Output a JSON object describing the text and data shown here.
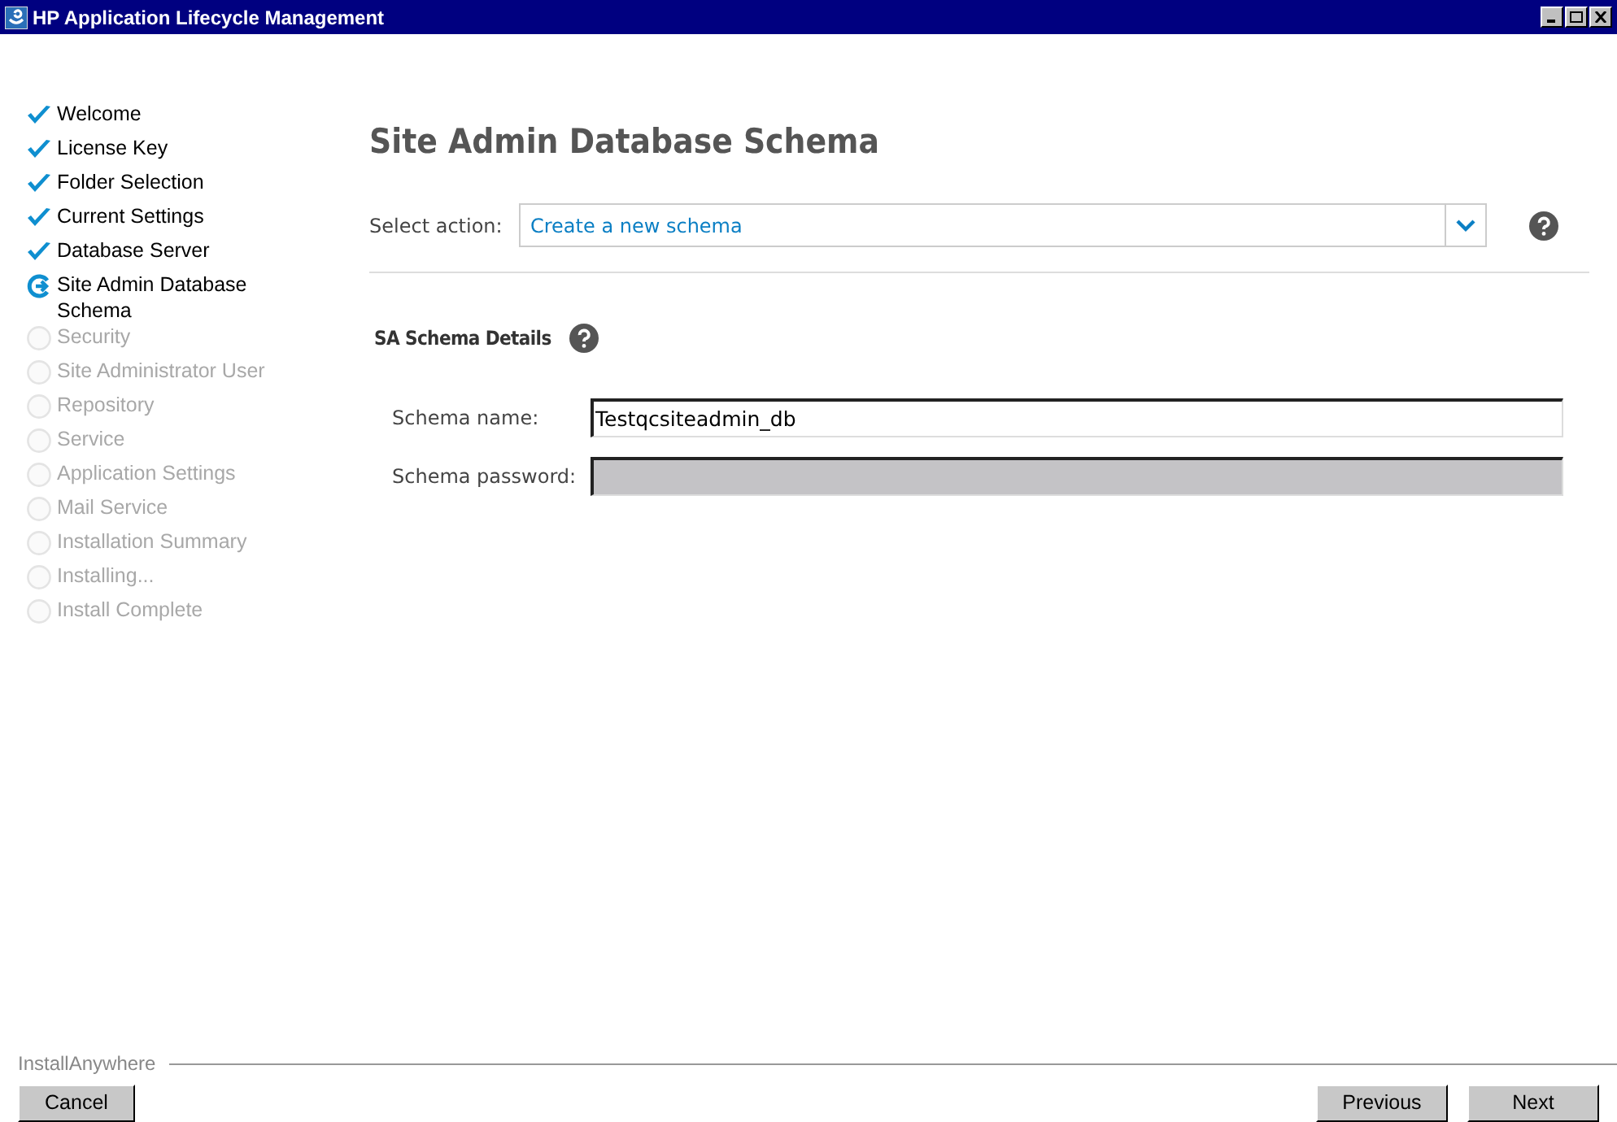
{
  "window": {
    "title": "HP Application Lifecycle Management"
  },
  "steps": [
    {
      "label": "Welcome",
      "kind": "done"
    },
    {
      "label": "License Key",
      "kind": "done"
    },
    {
      "label": "Folder Selection",
      "kind": "done"
    },
    {
      "label": "Current Settings",
      "kind": "done"
    },
    {
      "label": "Database Server",
      "kind": "done"
    },
    {
      "label": "Site Admin Database Schema",
      "kind": "current"
    },
    {
      "label": "Security",
      "kind": "pending"
    },
    {
      "label": "Site Administrator User",
      "kind": "pending"
    },
    {
      "label": "Repository",
      "kind": "pending"
    },
    {
      "label": "Service",
      "kind": "pending"
    },
    {
      "label": "Application Settings",
      "kind": "pending"
    },
    {
      "label": "Mail Service",
      "kind": "pending"
    },
    {
      "label": "Installation Summary",
      "kind": "pending"
    },
    {
      "label": "Installing...",
      "kind": "pending"
    },
    {
      "label": "Install Complete",
      "kind": "pending"
    }
  ],
  "page": {
    "heading": "Site Admin Database Schema",
    "select_action": {
      "label": "Select action:",
      "value": "Create a new schema"
    },
    "section_title": "SA Schema Details",
    "fields": [
      {
        "label": "Schema name:",
        "value": "Testqcsiteadmin_db",
        "disabled": false
      },
      {
        "label": "Schema password:",
        "disabled": true
      }
    ]
  },
  "footer": {
    "brand": "InstallAnywhere",
    "buttons": [
      {
        "label": "Cancel"
      },
      {
        "label": "Previous"
      },
      {
        "label": "Next"
      }
    ]
  }
}
